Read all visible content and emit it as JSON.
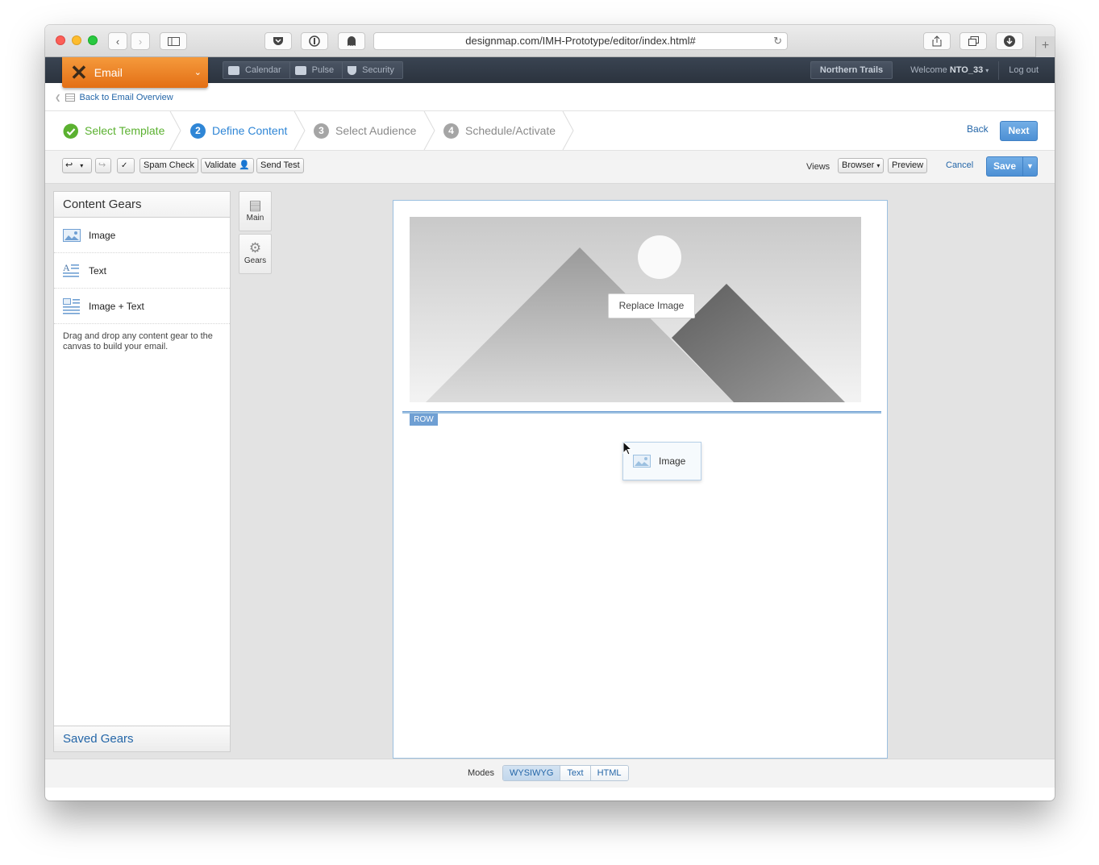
{
  "browser": {
    "url": "designmap.com/IMH-Prototype/editor/index.html#"
  },
  "app": {
    "name": "Email",
    "tabs": [
      {
        "label": "Calendar",
        "icon": "calendar-icon"
      },
      {
        "label": "Pulse",
        "icon": "pulse-icon"
      },
      {
        "label": "Security",
        "icon": "shield-icon"
      }
    ],
    "account": "Northern Trails",
    "welcome_prefix": "Welcome",
    "welcome_user": "NTO_33",
    "logout": "Log out"
  },
  "breadcrumb": {
    "label": "Back to Email Overview"
  },
  "wizard": {
    "steps": [
      {
        "number": "",
        "label": "Select Template",
        "state": "complete",
        "color": "#5bb130"
      },
      {
        "number": "2",
        "label": "Define Content",
        "state": "active",
        "color": "#2f86d6"
      },
      {
        "number": "3",
        "label": "Select Audience",
        "state": "pending",
        "color": "#9a9a9a"
      },
      {
        "number": "4",
        "label": "Schedule/Activate",
        "state": "pending",
        "color": "#9a9a9a"
      }
    ],
    "back": "Back",
    "next": "Next"
  },
  "toolbar": {
    "spam_check": "Spam Check",
    "validate": "Validate",
    "send_test": "Send Test",
    "views_label": "Views",
    "views_value": "Browser",
    "preview": "Preview",
    "cancel": "Cancel",
    "save": "Save"
  },
  "content_gears": {
    "title": "Content Gears",
    "items": [
      {
        "label": "Image",
        "icon": "image-icon"
      },
      {
        "label": "Text",
        "icon": "text-icon"
      },
      {
        "label": "Image + Text",
        "icon": "image-text-icon"
      }
    ],
    "hint": "Drag and drop any content gear to the canvas to build your email.",
    "saved": "Saved Gears"
  },
  "side_tabs": [
    {
      "label": "Main",
      "icon": "list-icon"
    },
    {
      "label": "Gears",
      "icon": "gear-icon"
    }
  ],
  "canvas": {
    "replace_image": "Replace Image",
    "row_tag": "ROW",
    "dragged_gear": "Image"
  },
  "modes": {
    "label": "Modes",
    "options": [
      "WYSIWYG",
      "Text",
      "HTML"
    ],
    "active": "WYSIWYG"
  },
  "colors": {
    "accent": "#4d90d4",
    "app_orange": "#e36f15",
    "link": "#2466a8"
  }
}
